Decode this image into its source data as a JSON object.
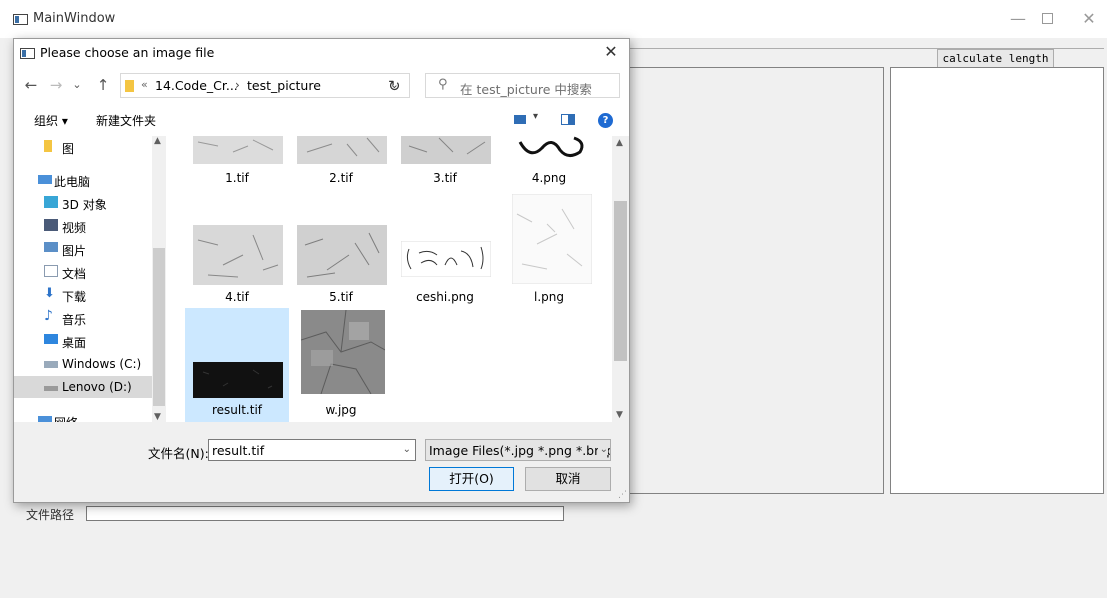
{
  "main_window": {
    "title": "MainWindow",
    "tab_label": "calculate length",
    "path_label": "文件路径",
    "path_value": ""
  },
  "dialog": {
    "title": "Please choose an image file",
    "close": "✕",
    "nav": {
      "back": "←",
      "forward": "→",
      "recent": "⌄",
      "up": "↑",
      "refresh": "↻"
    },
    "address": {
      "overflow": "«",
      "crumbs": [
        "14.Code_Cr...",
        "test_picture"
      ],
      "separator": "›",
      "dropdown": "⌄"
    },
    "search_placeholder": "在 test_picture 中搜索",
    "toolbar": {
      "organize": "组织 ▾",
      "new_folder": "新建文件夹",
      "help": "?"
    },
    "tree": [
      {
        "label": "图",
        "icon": "folder-icon",
        "level": "sub"
      },
      {
        "label": "此电脑",
        "icon": "computer-icon",
        "level": "top"
      },
      {
        "label": "3D 对象",
        "icon": "3d-objects-icon",
        "level": "sub"
      },
      {
        "label": "视频",
        "icon": "video-icon",
        "level": "sub"
      },
      {
        "label": "图片",
        "icon": "pictures-icon",
        "level": "sub"
      },
      {
        "label": "文档",
        "icon": "documents-icon",
        "level": "sub"
      },
      {
        "label": "下载",
        "icon": "download-icon",
        "level": "sub"
      },
      {
        "label": "音乐",
        "icon": "music-icon",
        "level": "sub"
      },
      {
        "label": "桌面",
        "icon": "desktop-icon",
        "level": "sub"
      },
      {
        "label": "Windows (C:)",
        "icon": "drive-icon",
        "level": "sub"
      },
      {
        "label": "Lenovo (D:)",
        "icon": "drive-icon",
        "level": "sub",
        "selected": true
      },
      {
        "label": "网络",
        "icon": "network-icon",
        "level": "top"
      }
    ],
    "files": [
      {
        "name": "1.tif",
        "thumb": "texture"
      },
      {
        "name": "2.tif",
        "thumb": "texture"
      },
      {
        "name": "3.tif",
        "thumb": "texture"
      },
      {
        "name": "4.png",
        "thumb": "sketch"
      },
      {
        "name": "4.tif",
        "thumb": "texture"
      },
      {
        "name": "5.tif",
        "thumb": "texture"
      },
      {
        "name": "ceshi.png",
        "thumb": "lines"
      },
      {
        "name": "l.png",
        "thumb": "light"
      },
      {
        "name": "result.tif",
        "thumb": "dark",
        "selected": true
      },
      {
        "name": "w.jpg",
        "thumb": "grains"
      }
    ],
    "filename_label": "文件名(N):",
    "filename_value": "result.tif",
    "filter_value": "Image Files(*.jpg *.png *.bmp",
    "open_button": "打开(O)",
    "cancel_button": "取消",
    "dropdown_glyph": "⌄",
    "scroll_up": "▲",
    "scroll_down": "▼"
  },
  "colors": {
    "selection": "#cce8ff",
    "accent": "#0078d7",
    "tree_selected": "#d9d9d9"
  }
}
